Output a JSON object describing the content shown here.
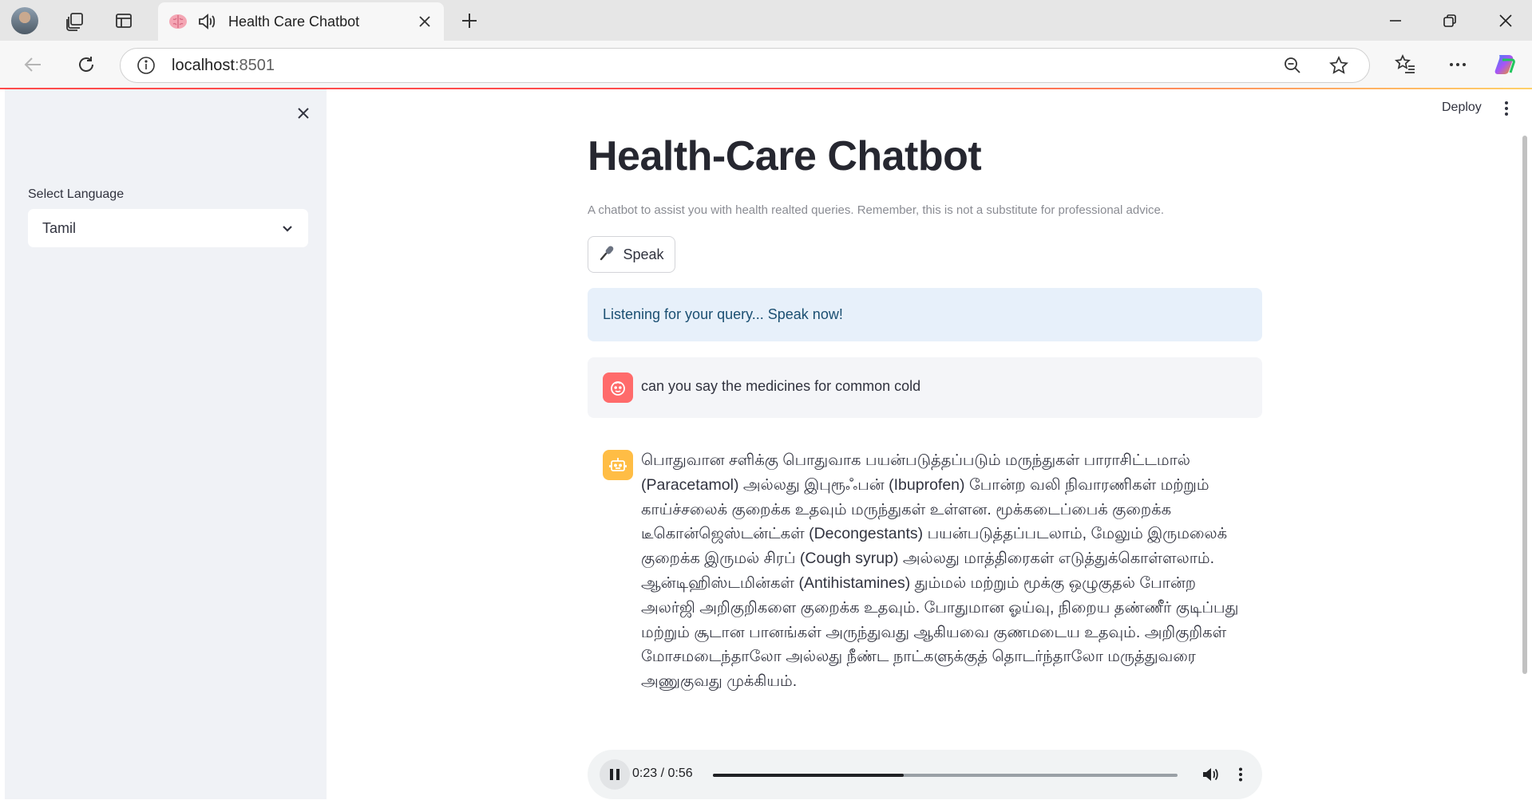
{
  "browser": {
    "tab": {
      "title": "Health Care Chatbot",
      "favicon": "brain-icon",
      "audio_icon": "speaker-icon"
    },
    "address": {
      "host": "localhost",
      "port": ":8501"
    },
    "colors": {
      "titlebar": "#e6e6e6",
      "toolbar": "#f7f7f7",
      "progress": "#ff4b4b"
    }
  },
  "sidebar": {
    "language_label": "Select Language",
    "language_value": "Tamil"
  },
  "header": {
    "deploy_label": "Deploy"
  },
  "main": {
    "title": "Health-Care Chatbot",
    "caption": "A chatbot to assist you with health realted queries. Remember, this is not a substitute for professional advice.",
    "speak_button": {
      "icon": "microphone-icon",
      "label": "Speak"
    },
    "info_message": "Listening for your query... Speak now!",
    "messages": [
      {
        "role": "user",
        "avatar": "face-icon",
        "text": "can you say the medicines for common cold"
      },
      {
        "role": "assistant",
        "avatar": "robot-icon",
        "text": "பொதுவான சளிக்கு பொதுவாக பயன்படுத்தப்படும் மருந்துகள் பாராசிட்டமால் (Paracetamol) அல்லது இபுரூஃபன் (Ibuprofen) போன்ற வலி நிவாரணிகள் மற்றும் காய்ச்சலைக் குறைக்க உதவும் மருந்துகள் உள்ளன. மூக்கடைப்பைக் குறைக்க டீகொன்ஜெஸ்டன்ட்கள் (Decongestants) பயன்படுத்தப்படலாம், மேலும் இருமலைக் குறைக்க இருமல் சிரப் (Cough syrup) அல்லது மாத்திரைகள் எடுத்துக்கொள்ளலாம். ஆன்டிஹிஸ்டமின்கள் (Antihistamines) தும்மல் மற்றும் மூக்கு ஒழுகுதல் போன்ற அலர்ஜி அறிகுறிகளை குறைக்க உதவும். போதுமான ஓய்வு, நிறைய தண்ணீர் குடிப்பது மற்றும் சூடான பானங்கள் அருந்துவது ஆகியவை குணமடைய உதவும். அறிகுறிகள் மோசமடைந்தாலோ அல்லது நீண்ட நாட்களுக்குத் தொடர்ந்தாலோ மருத்துவரை அணுகுவது முக்கியம்."
      }
    ],
    "audio": {
      "current": "0:23",
      "duration": "0:56",
      "time_display": "0:23 / 0:56",
      "progress_fraction": 0.41,
      "state": "playing"
    },
    "colors": {
      "info_bg": "#e7f0fa",
      "user_avatar": "#ff6b6b",
      "bot_avatar": "#ffbd45",
      "sidebar_bg": "#f0f2f6"
    }
  }
}
